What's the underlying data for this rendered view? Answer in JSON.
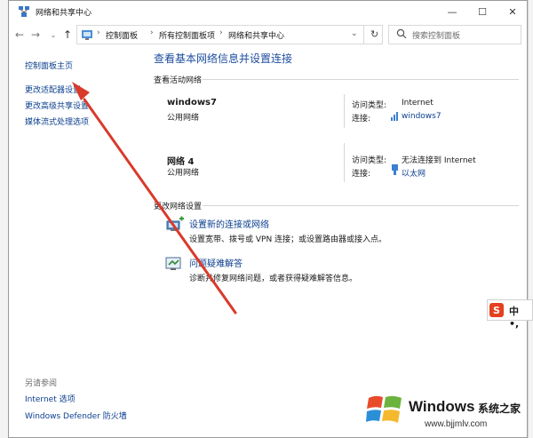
{
  "window": {
    "title": "网络和共享中心"
  },
  "controls": {
    "minimize": "—",
    "maximize": "☐",
    "close": "✕"
  },
  "address": {
    "crumbs": [
      "控制面板",
      "所有控制面板项",
      "网络和共享中心"
    ],
    "search_placeholder": "搜索控制面板"
  },
  "sidebar": {
    "items": [
      {
        "label": "控制面板主页"
      },
      {
        "label": "更改适配器设置"
      },
      {
        "label": "更改高级共享设置"
      },
      {
        "label": "媒体流式处理选项"
      }
    ],
    "see_also": "另请参阅",
    "see_also_items": [
      {
        "label": "Internet 选项"
      },
      {
        "label": "Windows Defender 防火墙"
      }
    ]
  },
  "main": {
    "heading": "查看基本网络信息并设置连接",
    "active_label": "查看活动网络",
    "networks": [
      {
        "name": "windows7",
        "type": "公用网络",
        "access_label": "访问类型:",
        "access_value": "Internet",
        "conn_label": "连接:",
        "conn_value": "windows7"
      },
      {
        "name": "网络 4",
        "type": "公用网络",
        "access_label": "访问类型:",
        "access_value": "无法连接到 Internet",
        "conn_label": "连接:",
        "conn_value": "以太网"
      }
    ],
    "change_label": "更改网络设置",
    "tasks": [
      {
        "title": "设置新的连接或网络",
        "desc": "设置宽带、拨号或 VPN 连接；或设置路由器或接入点。"
      },
      {
        "title": "问题疑难解答",
        "desc": "诊断并修复网络问题，或者获得疑难解答信息。"
      }
    ]
  },
  "ime": {
    "logo": "S",
    "text": "中 •,"
  },
  "watermark": {
    "brand": "Windows",
    "cn": "系统之家",
    "url": "www.bjjmlv.com"
  },
  "colors": {
    "link": "#0b3f8e",
    "heading": "#1d4d9e",
    "arrow": "#d93a2b"
  }
}
